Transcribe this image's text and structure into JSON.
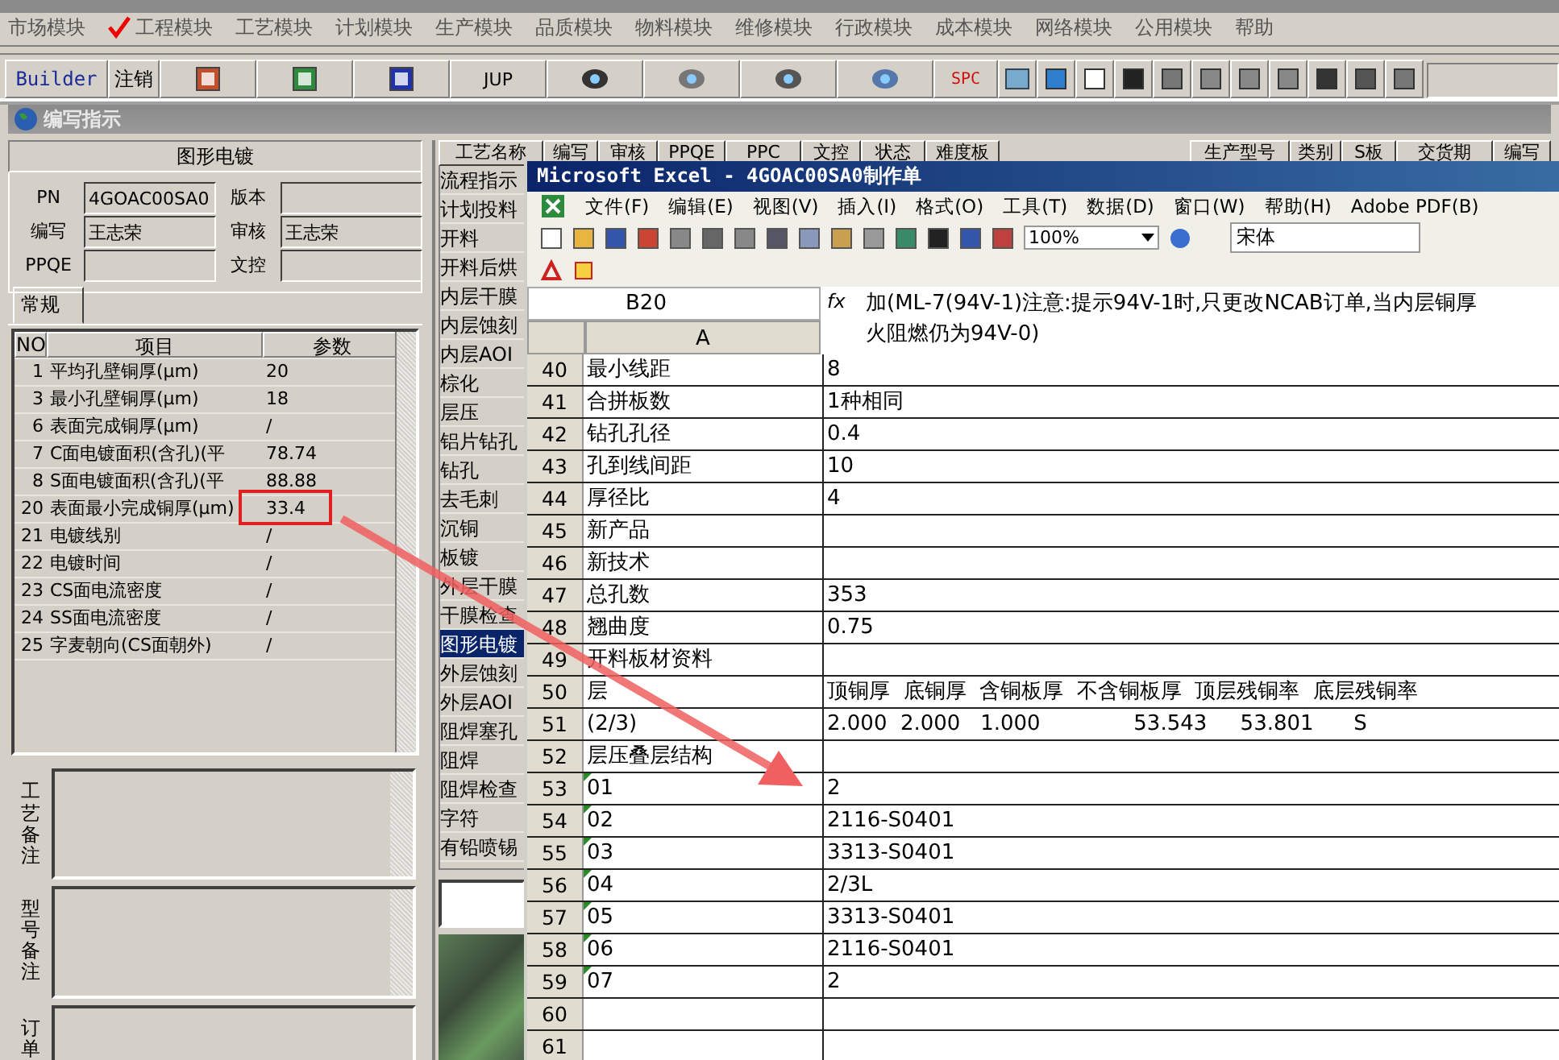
{
  "menu": [
    {
      "label": "市场模块",
      "checked": false
    },
    {
      "label": "工程模块",
      "checked": true
    },
    {
      "label": "工艺模块",
      "checked": false
    },
    {
      "label": "计划模块",
      "checked": false
    },
    {
      "label": "生产模块",
      "checked": false
    },
    {
      "label": "品质模块",
      "checked": false
    },
    {
      "label": "物料模块",
      "checked": false
    },
    {
      "label": "维修模块",
      "checked": false
    },
    {
      "label": "行政模块",
      "checked": false
    },
    {
      "label": "成本模块",
      "checked": false
    },
    {
      "label": "网络模块",
      "checked": false
    },
    {
      "label": "公用模块",
      "checked": false
    },
    {
      "label": "帮助",
      "checked": false
    }
  ],
  "toolbar": {
    "builder": "Builder",
    "logout": "注销",
    "jup": "JUP",
    "spc": "SPC"
  },
  "child_window": {
    "title": "编写指示"
  },
  "left_panel": {
    "header": "图形电镀",
    "fields": [
      {
        "label": "PN",
        "value": "4GOAC00SA0"
      },
      {
        "label": "版本"
      },
      {
        "label": "编写",
        "value": "王志荣"
      },
      {
        "label": "审核",
        "value": "王志荣"
      },
      {
        "label": "PPQE"
      },
      {
        "label": "文控"
      }
    ],
    "tab": "常规",
    "table": {
      "columns": [
        "NO",
        "项目",
        "参数"
      ],
      "rows": [
        [
          "1",
          "平均孔壁铜厚(μm)",
          "20"
        ],
        [
          "3",
          "最小孔壁铜厚(μm)",
          "18"
        ],
        [
          "6",
          "表面完成铜厚(μm)",
          "/"
        ],
        [
          "7",
          "C面电镀面积(含孔)(平",
          "78.74"
        ],
        [
          "8",
          "S面电镀面积(含孔)(平",
          "88.88"
        ],
        [
          "20",
          "表面最小完成铜厚(μm)",
          "33.4"
        ],
        [
          "21",
          "电镀线别",
          "/"
        ],
        [
          "22",
          "电镀时间",
          "/"
        ],
        [
          "23",
          "CS面电流密度",
          "/"
        ],
        [
          "24",
          "SS面电流密度",
          "/"
        ],
        [
          "25",
          "字麦朝向(CS面朝外)",
          "/"
        ]
      ]
    },
    "remarks": [
      "工艺备注",
      "型号备注",
      "订单"
    ]
  },
  "right_panel": {
    "columns": [
      "工艺名称",
      "编写",
      "审核",
      "PPQE",
      "PPC",
      "文控",
      "状态",
      "难度板",
      "生产型号",
      "类别",
      "S板",
      "交货期",
      "编写"
    ],
    "processes": [
      {
        "label": "流程指示",
        "selected": false
      },
      {
        "label": "计划投料",
        "selected": false
      },
      {
        "label": "开料",
        "selected": false
      },
      {
        "label": "开料后烘",
        "selected": false
      },
      {
        "label": "内层干膜",
        "selected": false
      },
      {
        "label": "内层蚀刻",
        "selected": false
      },
      {
        "label": "内层AOI",
        "selected": false
      },
      {
        "label": "棕化",
        "selected": false
      },
      {
        "label": "层压",
        "selected": false
      },
      {
        "label": "铝片钻孔",
        "selected": false
      },
      {
        "label": "钻孔",
        "selected": false
      },
      {
        "label": "去毛刺",
        "selected": false
      },
      {
        "label": "沉铜",
        "selected": false
      },
      {
        "label": "板镀",
        "selected": false
      },
      {
        "label": "外层干膜",
        "selected": false
      },
      {
        "label": "干膜检查",
        "selected": false
      },
      {
        "label": "图形电镀",
        "selected": true
      },
      {
        "label": "外层蚀刻",
        "selected": false
      },
      {
        "label": "外层AOI",
        "selected": false
      },
      {
        "label": "阻焊塞孔",
        "selected": false
      },
      {
        "label": "阻焊",
        "selected": false
      },
      {
        "label": "阻焊检查",
        "selected": false
      },
      {
        "label": "字符",
        "selected": false
      },
      {
        "label": "有铅喷锡",
        "selected": false
      }
    ]
  },
  "excel": {
    "title": "Microsoft Excel - 4GOAC00SA0制作单",
    "menu": [
      "文件(F)",
      "编辑(E)",
      "视图(V)",
      "插入(I)",
      "格式(O)",
      "工具(T)",
      "数据(D)",
      "窗口(W)",
      "帮助(H)",
      "Adobe PDF(B)"
    ],
    "zoom": "100%",
    "font": "宋体",
    "name_box": "B20",
    "fx": "fx",
    "formula": [
      "加(ML-7(94V-1)注意:提示94V-1时,只更改NCAB订单,当内层铜厚",
      "火阻燃仍为94V-0)"
    ],
    "column": "A",
    "rows": [
      {
        "n": "40",
        "a": "最小线距",
        "b": "8",
        "flag": false
      },
      {
        "n": "41",
        "a": "合拼板数",
        "b": "1种相同",
        "flag": false
      },
      {
        "n": "42",
        "a": "钻孔孔径",
        "b": "0.4",
        "flag": false
      },
      {
        "n": "43",
        "a": "孔到线间距",
        "b": "10",
        "flag": false
      },
      {
        "n": "44",
        "a": "厚径比",
        "b": "4",
        "flag": false
      },
      {
        "n": "45",
        "a": "新产品",
        "b": "",
        "flag": false
      },
      {
        "n": "46",
        "a": "新技术",
        "b": "",
        "flag": false
      },
      {
        "n": "47",
        "a": "总孔数",
        "b": "353",
        "flag": false
      },
      {
        "n": "48",
        "a": "翘曲度",
        "b": "0.75",
        "flag": false
      },
      {
        "n": "49",
        "a": "开料板材资料",
        "b": "",
        "flag": false
      },
      {
        "n": "50",
        "a": "层",
        "b": "顶铜厚  底铜厚  含铜板厚  不含铜板厚  顶层残铜率  底层残铜率",
        "flag": false
      },
      {
        "n": "51",
        "a": "(2/3)",
        "b": "2.000  2.000   1.000              53.543     53.801      S",
        "flag": false
      },
      {
        "n": "52",
        "a": "层压叠层结构",
        "b": "",
        "flag": false
      },
      {
        "n": "53",
        "a": "01",
        "b": "2",
        "flag": true
      },
      {
        "n": "54",
        "a": "02",
        "b": "2116-S0401",
        "flag": true
      },
      {
        "n": "55",
        "a": "03",
        "b": "3313-S0401",
        "flag": true
      },
      {
        "n": "56",
        "a": "04",
        "b": "2/3L",
        "flag": true
      },
      {
        "n": "57",
        "a": "05",
        "b": "3313-S0401",
        "flag": true
      },
      {
        "n": "58",
        "a": "06",
        "b": "2116-S0401",
        "flag": true
      },
      {
        "n": "59",
        "a": "07",
        "b": "2",
        "flag": true
      },
      {
        "n": "60",
        "a": "",
        "b": "",
        "flag": false
      },
      {
        "n": "61",
        "a": "",
        "b": "",
        "flag": false
      }
    ]
  }
}
